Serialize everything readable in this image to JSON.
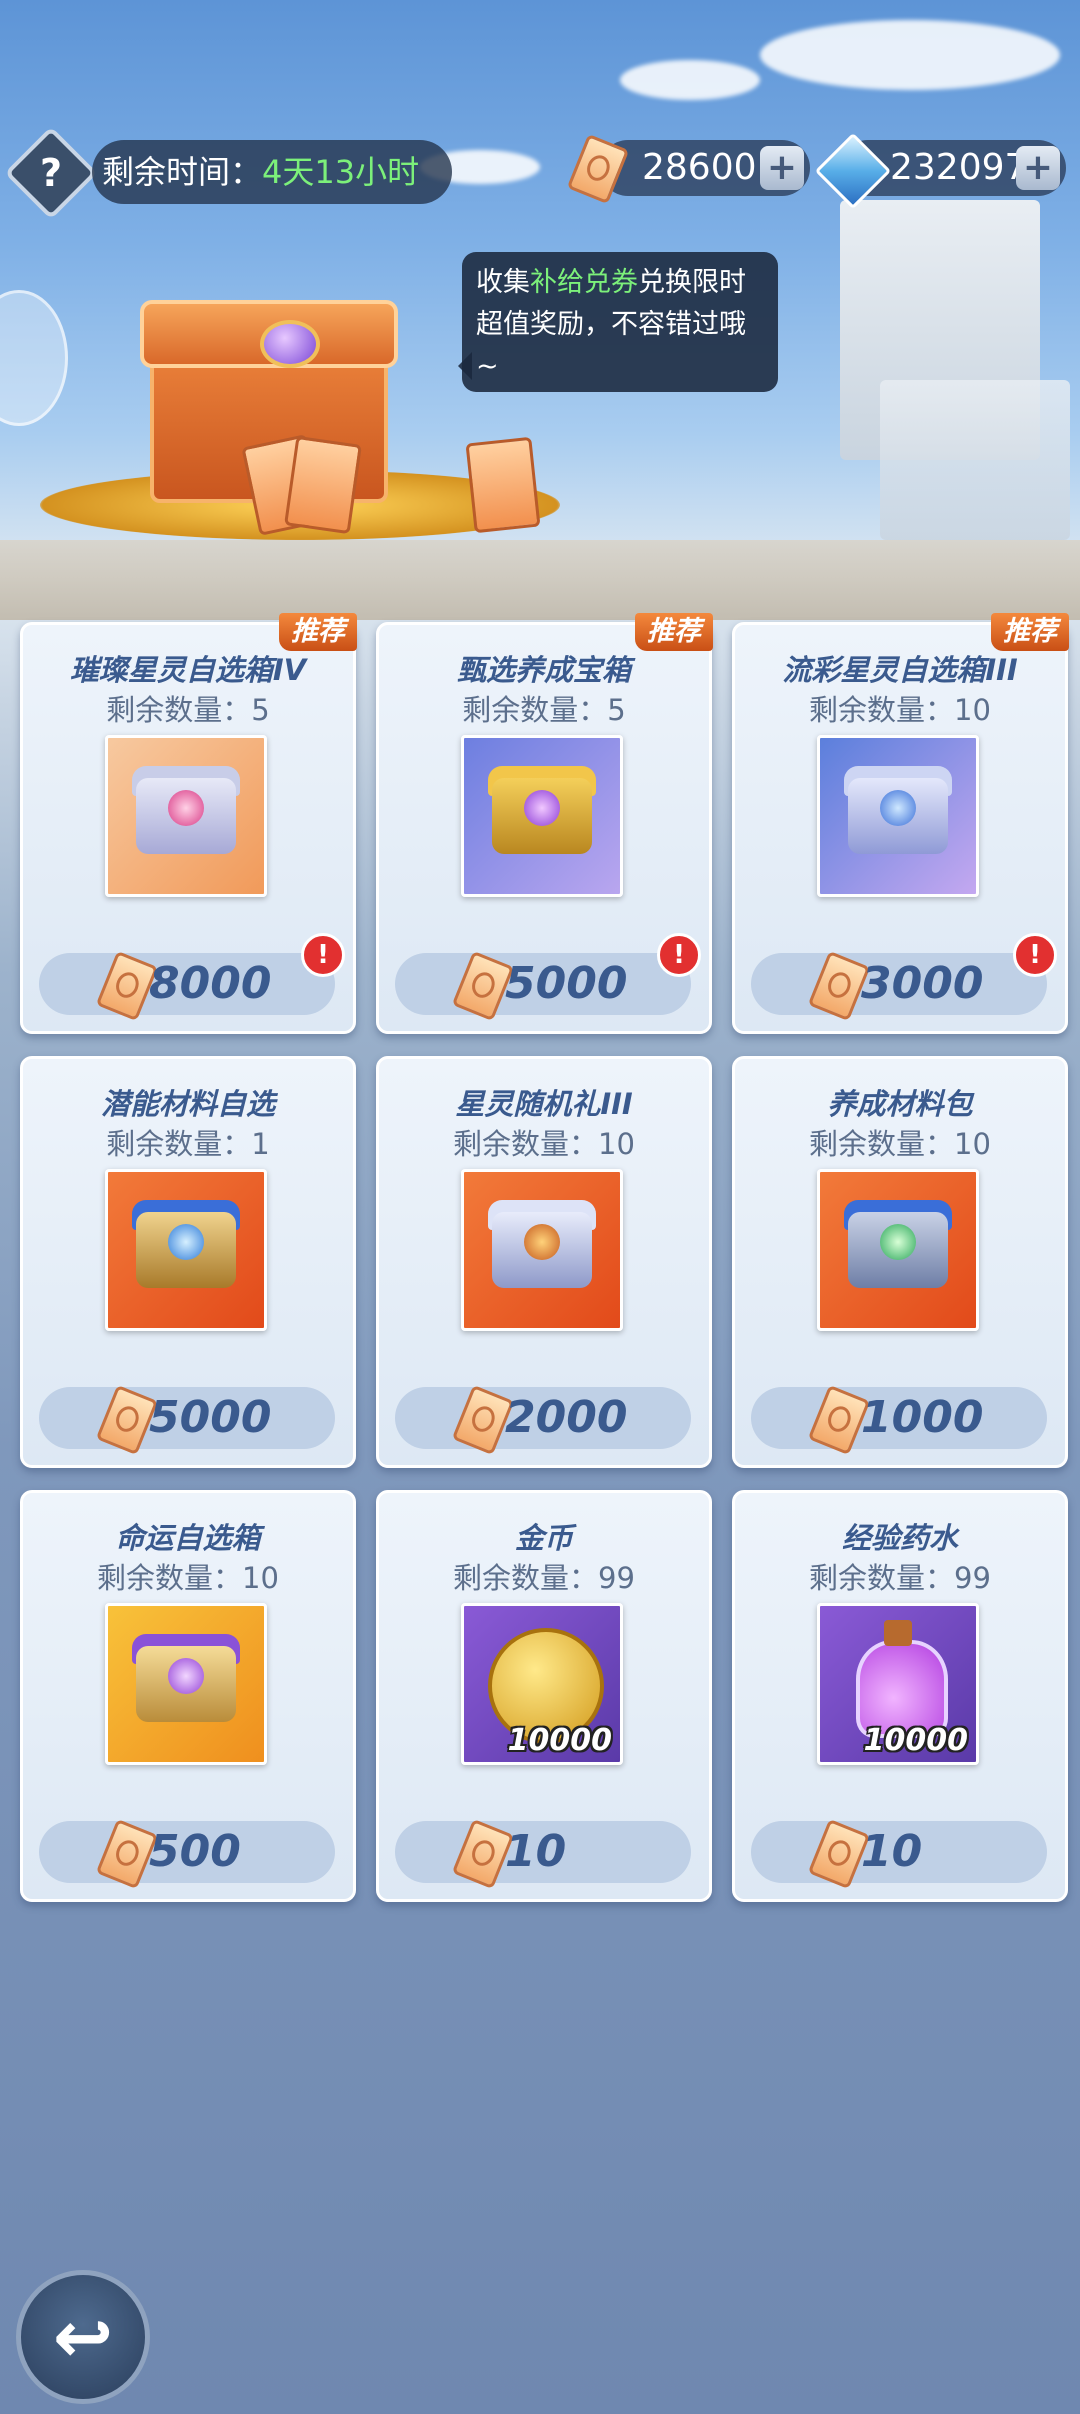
{
  "header": {
    "help_label": "?",
    "timer_prefix": "剩余时间：",
    "timer_value": "4天13小时",
    "tickets_amount": "28600",
    "diamonds_amount": "232097",
    "plus_label": "+"
  },
  "bubble": {
    "text_before": "收集",
    "highlight": "补给兑券",
    "text_after": "兑换限时超值奖励，不容错过哦~"
  },
  "shop": {
    "recommend_label": "推荐",
    "qty_prefix": "剩余数量：",
    "items": [
      {
        "name": "璀璨星灵自选箱IV",
        "qty": "5",
        "price": "8000",
        "recommended": true,
        "alert": "!"
      },
      {
        "name": "甄选养成宝箱",
        "qty": "5",
        "price": "5000",
        "recommended": true,
        "alert": "!"
      },
      {
        "name": "流彩星灵自选箱III",
        "qty": "10",
        "price": "3000",
        "recommended": true,
        "alert": "!"
      },
      {
        "name": "潜能材料自选",
        "qty": "1",
        "price": "5000"
      },
      {
        "name": "星灵随机礼III",
        "qty": "10",
        "price": "2000"
      },
      {
        "name": "养成材料包",
        "qty": "10",
        "price": "1000"
      },
      {
        "name": "命运自选箱",
        "qty": "10",
        "price": "500"
      },
      {
        "name": "金币",
        "qty": "99",
        "price": "10",
        "amount": "10000"
      },
      {
        "name": "经验药水",
        "qty": "99",
        "price": "10",
        "amount": "10000"
      }
    ]
  },
  "icons": {
    "help": "question-icon",
    "ticket": "ticket-icon",
    "diamond": "diamond-icon",
    "back": "back-arrow-icon"
  },
  "colors": {
    "accent_green": "#7cf07a",
    "recommend_orange": "#e06a25",
    "price_text": "#3a5a8e",
    "alert_red": "#e23030"
  }
}
